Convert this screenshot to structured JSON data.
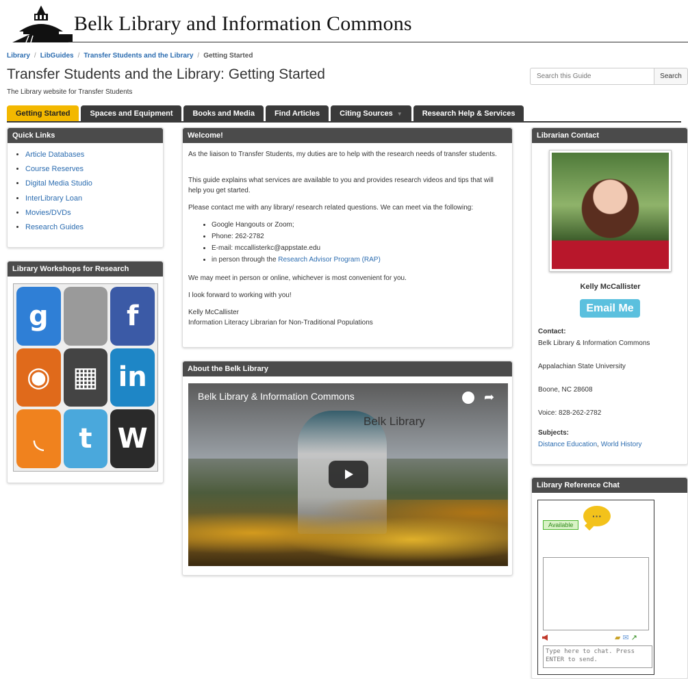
{
  "header": {
    "site_title": "Belk Library and Information Commons"
  },
  "breadcrumb": {
    "items": [
      "Library",
      "LibGuides",
      "Transfer Students and the Library",
      "Getting Started"
    ]
  },
  "guide": {
    "title": "Transfer Students and the Library: Getting Started",
    "subtitle": "The Library website for Transfer Students"
  },
  "search": {
    "placeholder": "Search this Guide",
    "button_label": "Search"
  },
  "tabs": [
    {
      "label": "Getting Started",
      "active": true
    },
    {
      "label": "Spaces and Equipment"
    },
    {
      "label": "Books and Media"
    },
    {
      "label": "Find Articles"
    },
    {
      "label": "Citing Sources"
    },
    {
      "label": "Research Help & Services"
    }
  ],
  "quick_links": {
    "title": "Quick Links",
    "items": [
      "Article Databases",
      "Course Reserves",
      "Digital Media Studio",
      "InterLibrary Loan",
      "Movies/DVDs",
      "Research Guides"
    ]
  },
  "workshops": {
    "title": "Library Workshops for Research",
    "tiles": [
      {
        "icon": "google-icon",
        "glyph": "g",
        "color": "#2f7fd6"
      },
      {
        "icon": "apple-icon",
        "glyph": "",
        "color": "#9a9a9a"
      },
      {
        "icon": "facebook-icon",
        "glyph": "f",
        "color": "#3b5aa6"
      },
      {
        "icon": "firefox-icon",
        "glyph": "◉",
        "color": "#e06a1b"
      },
      {
        "icon": "delicious-icon",
        "glyph": "▦",
        "color": "#444444"
      },
      {
        "icon": "linkedin-icon",
        "glyph": "in",
        "color": "#1e86c6"
      },
      {
        "icon": "rss-icon",
        "glyph": "◟",
        "color": "#f0821e"
      },
      {
        "icon": "twitter-icon",
        "glyph": "t",
        "color": "#4aa8dc"
      },
      {
        "icon": "wordpress-icon",
        "glyph": "W",
        "color": "#2a2a2a"
      }
    ]
  },
  "welcome": {
    "title": "Welcome!",
    "p1": "As the liaison to Transfer Students, my duties are to help with the research needs of transfer students.",
    "p2": "This guide explains what services are available to you and provides research videos and tips that will help you get started.",
    "p3": "Please contact me with any library/ research related questions. We can meet via the following:",
    "list": [
      "Google Hangouts or Zoom;",
      "Phone: 262-2782",
      "E-mail: mccallisterkc@appstate.edu"
    ],
    "list_last_prefix": "in person through the ",
    "list_last_link": "Research Advisor Program (RAP)",
    "p4": "We may meet in person or online, whichever is most convenient for you.",
    "p5": "I look forward to working with you!",
    "sig_name": "Kelly McCallister",
    "sig_title": "Information Literacy Librarian for Non-Traditional Populations"
  },
  "about": {
    "title": "About the Belk Library",
    "video_title": "Belk Library & Information Commons",
    "video_watermark": "Belk Library"
  },
  "librarian": {
    "title": "Librarian Contact",
    "name": "Kelly McCallister",
    "email_button": "Email Me",
    "contact_label": "Contact:",
    "contact_lines": [
      "Belk Library & Information Commons",
      "Appalachian State University",
      "Boone, NC 28608",
      "Voice: 828-262-2782"
    ],
    "subjects_label": "Subjects:",
    "subjects": [
      "Distance Education",
      "World History"
    ]
  },
  "chat": {
    "title": "Library Reference Chat",
    "status": "Available",
    "bubble": "···",
    "input_placeholder": "Type here to chat. Press ENTER to send."
  },
  "colors": {
    "accent": "#f3b800",
    "tab_dark": "#3a3a3a",
    "link": "#2b6cb0",
    "email_button": "#5bc0de"
  }
}
